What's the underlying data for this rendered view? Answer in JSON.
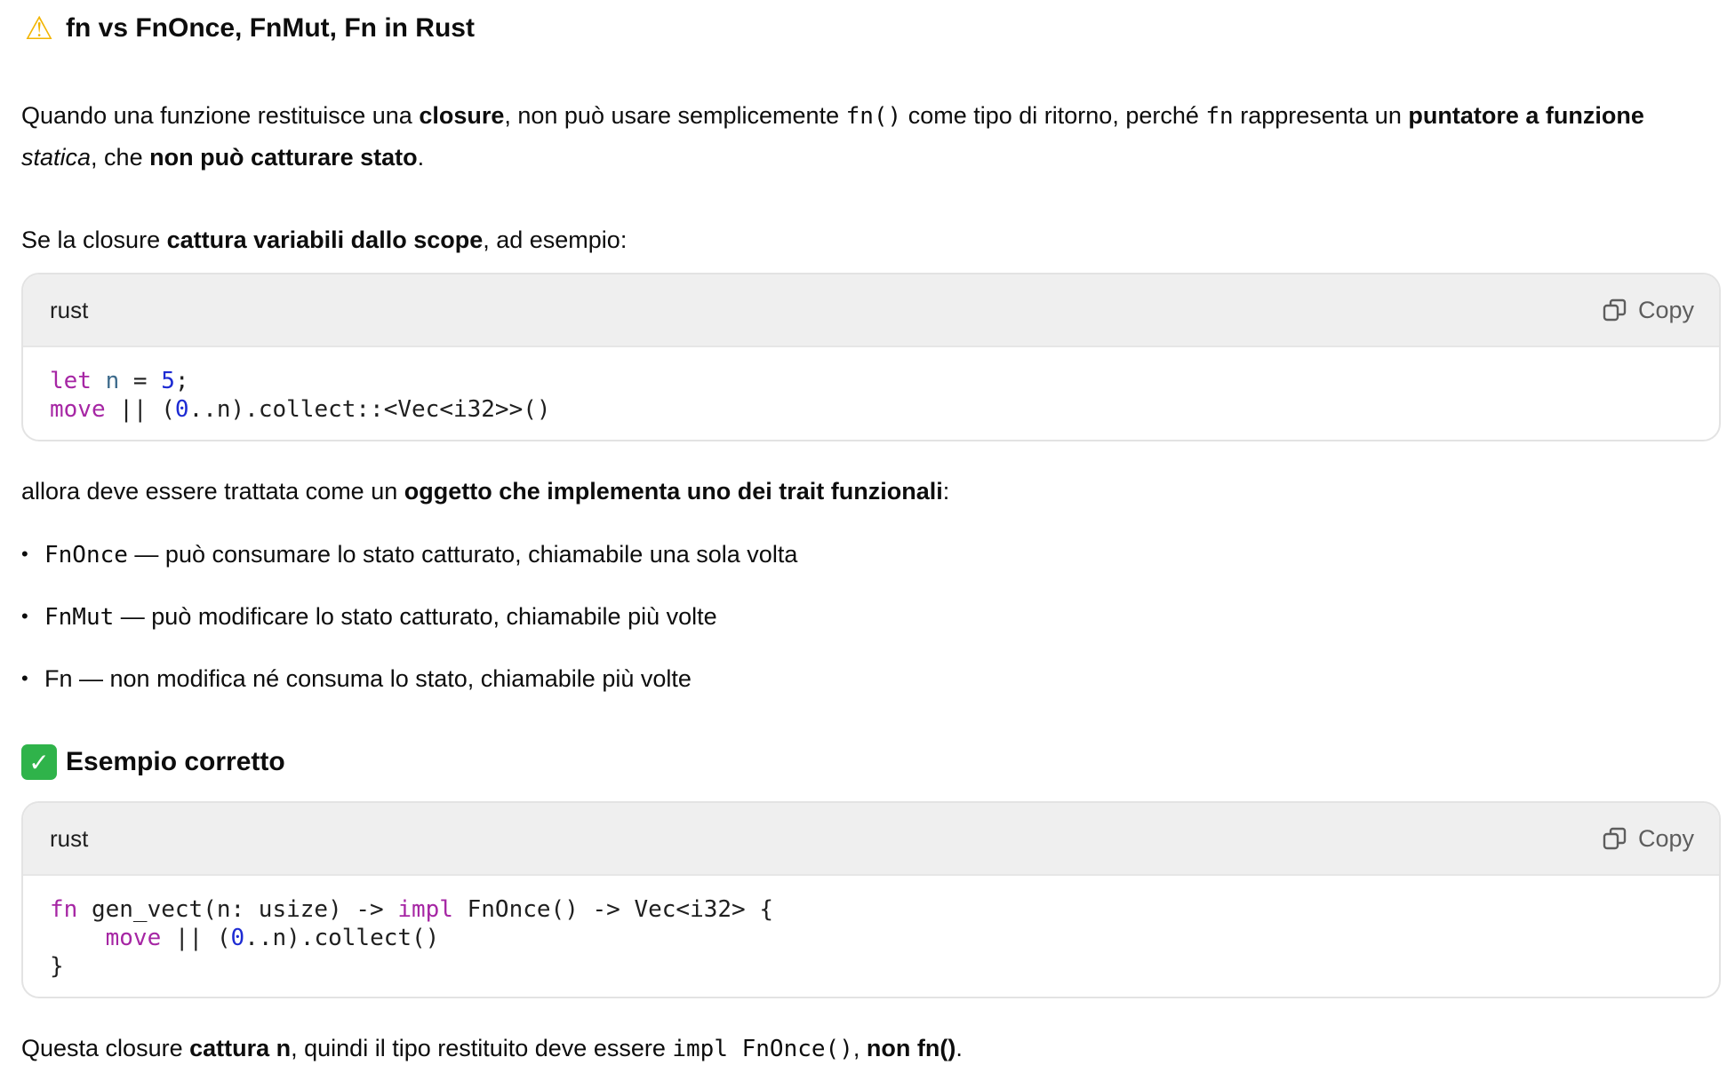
{
  "heading1": {
    "icon": "warning-icon",
    "text": "fn vs FnOnce, FnMut, Fn in Rust"
  },
  "para1": {
    "t1": "Quando una funzione restituisce una ",
    "b1": "closure",
    "t2": ", non può usare semplicemente ",
    "c1": "fn()",
    "t3": " come tipo di ritorno, perché ",
    "c2": "fn",
    "t4": " rappresenta un ",
    "b2": "puntatore a funzione",
    "t5": " ",
    "i1": "statica",
    "t6": ", che ",
    "b3": "non può catturare stato",
    "t7": "."
  },
  "para2": {
    "t1": "Se la closure ",
    "b1": "cattura variabili dallo scope",
    "t2": ", ad esempio:"
  },
  "code1": {
    "language": "rust",
    "copy_label": "Copy",
    "lines": [
      "let n = 5;",
      "move || (0..n).collect::<Vec<i32>>()"
    ]
  },
  "para3": {
    "t1": "allora deve essere trattata come un ",
    "b1": "oggetto che implementa uno dei trait funzionali",
    "t2": ":"
  },
  "bullets": [
    {
      "code": "FnOnce",
      "text": " — può consumare lo stato catturato, chiamabile una sola volta"
    },
    {
      "code": "FnMut",
      "text": " — può modificare lo stato catturato, chiamabile più volte"
    },
    {
      "code": "Fn",
      "text": " — non modifica né consuma lo stato, chiamabile più volte"
    }
  ],
  "heading2": {
    "icon": "check-mark-icon",
    "text": "Esempio corretto"
  },
  "code2": {
    "language": "rust",
    "copy_label": "Copy",
    "lines": [
      "fn gen_vect(n: usize) -> impl FnOnce() -> Vec<i32> {",
      "    move || (0..n).collect()",
      "}"
    ]
  },
  "para4": {
    "t1": "Questa closure ",
    "b1": "cattura n",
    "t2": ", quindi il tipo restituito deve essere ",
    "c1": "impl FnOnce()",
    "t3": ", ",
    "b2": "non fn()",
    "t4": "."
  }
}
